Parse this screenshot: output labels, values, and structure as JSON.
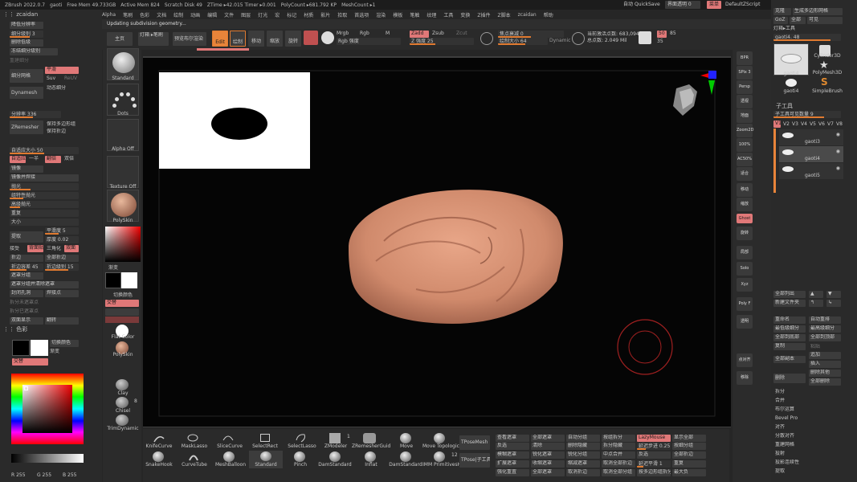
{
  "titlebar": {
    "app": "ZBrush 2022.0.7",
    "doc": "gaoti",
    "freemem": "Free Mem 49.733GB",
    "activemem": "Active Mem 824",
    "scratch": "Scratch Disk 49",
    "ztime": "ZTime ▸42.015 Timer ▸0.001",
    "polycount": "PolyCount ▸681.792 KP",
    "meshcount": "MeshCount ▸1",
    "auto": "自动",
    "quicksave": "QuickSave",
    "transparency": "界面透明 0",
    "menu": "菜单",
    "script": "DefaultZScript"
  },
  "menubar": [
    "Alpha",
    "笔刷",
    "色彩",
    "文档",
    "绘制",
    "动画",
    "编辑",
    "文件",
    "图层",
    "灯光",
    "宏",
    "标记",
    "材质",
    "影片",
    "拾取",
    "首选项",
    "渲染",
    "模板",
    "笔触",
    "纹理",
    "工具",
    "变换",
    "Z插件",
    "Z脚本",
    "zcaidan",
    "帮助"
  ],
  "status": "Updating subdivision geometry...",
  "toolbar": {
    "home": "主页",
    "lightbox": "灯箱 ▸笔刷",
    "preview": "预览布尔渲染",
    "edit": "Edit",
    "draw": "绘制",
    "move": "移动",
    "scale": "缩放",
    "rotate": "旋转",
    "mrgb": "Mrgb",
    "rgb": "Rgb",
    "m": "M",
    "zadd": "Zadd",
    "zsub": "Zsub",
    "zcut": "Zcut",
    "rgb_intensity": "Rgb 强度",
    "z_intensity": "Z 强度 25",
    "focal": "焦点衰减 0",
    "draw_size": "绘制大小 64",
    "dynamic": "Dynamic",
    "active_pts": "当前激活点数: 683,094",
    "total_pts": "总点数: 2.049 Mil",
    "num1": "50",
    "num2": "85",
    "num3": "35"
  },
  "left": {
    "title": "zcaidan",
    "items": [
      "降低分辨率",
      "细分级别 3",
      "删除低级",
      "冻结细分级别",
      "重建细分",
      "细分网格",
      "平滑",
      "Suv",
      "ReUV",
      "Dynamesh",
      "动态细分",
      "分辨率 336",
      "自适应大小 50",
      "ZRemesher",
      "保持多边形组",
      "保持折边",
      "自适应",
      "一半",
      "翻倍",
      "双倍",
      "镜像",
      "镜像并焊接",
      "抛光",
      "组特性抛光",
      "高级抛光",
      "重复",
      "大小",
      "平滑度 5",
      "厚度 0.02",
      "提取",
      "接受",
      "背面贴",
      "三角化",
      "双面",
      "折边",
      "全部折边",
      "折边容差 45",
      "折边级别 15",
      "遮罩分组",
      "遮罩分组并清除遮罩",
      "封闭孔洞",
      "焊接点",
      "拆分未遮罩点",
      "拆分已遮罩点",
      "双面显示",
      "翻转"
    ],
    "color_title": "色彩",
    "switch_color": "切换颜色",
    "gradient": "渐变",
    "alternate": "交替",
    "r": "R 255",
    "g": "G 255",
    "b": "B 255"
  },
  "tools_col": {
    "standard": "Standard",
    "dots": "Dots",
    "alphaoff": "Alpha Off",
    "textureoff": "Texture Off",
    "polyskin": "PolySkin",
    "gradient": "渐变",
    "switch_color": "切换颜色",
    "alternate": "交替",
    "flatcolor": "Flat Color",
    "polyskin2": "PolySkin",
    "clay": "Clay",
    "chisel": "Chisel",
    "trimdynamic": "TrimDynamic",
    "eight": "8"
  },
  "right_icons": [
    "BPR",
    "SPix 3",
    "Persp",
    "透视",
    "地面",
    "Zoom2D",
    "100%",
    "AC50%",
    "适合",
    "移动",
    "缩放",
    "旋转",
    "Poly F",
    "透明",
    "Ghost",
    "Solo",
    "Xyz",
    "点对齐",
    "移除",
    "局部"
  ],
  "right_panel": {
    "top_items": [
      "克隆",
      "生成多边形网格",
      "GoZ",
      "全部",
      "可见",
      "灯箱▸工具",
      "gaoti4. 48"
    ],
    "tools": [
      "gaoti4",
      "Cylinder3D",
      "PolyMesh3D",
      "gaoti4",
      "SimpleBrush"
    ],
    "subtool_title": "子工具",
    "visible_count": "子工具可见数量 9",
    "vtabs": [
      "V1",
      "V2",
      "V3",
      "V4",
      "V5",
      "V6",
      "V7",
      "V8"
    ],
    "subtools": [
      "gaoti3",
      "gaoti4",
      "gaoti5"
    ],
    "list_all": "全部列出",
    "new_folder": "新建文件夹",
    "actions": [
      "重命名",
      "自动重排",
      "最低级细分",
      "最高级细分",
      "全部到底部",
      "全部到顶部",
      "复制",
      "粘贴",
      "全部副本",
      "追加",
      "插入",
      "删除",
      "删除其他",
      "全部删除",
      "拆分",
      "合并",
      "布尔运算",
      "Bevel Pro",
      "对齐",
      "分散对齐",
      "重建网格",
      "投射",
      "投影连续性",
      "提取"
    ]
  },
  "bottom": {
    "brushes": [
      "KnifeCurve",
      "MaskLasso",
      "SliceCurve",
      "SelectRect",
      "SelectLasso",
      "ZModeler",
      "ZRemesherGuid",
      "Move",
      "Move Topologica",
      "SnakeHook",
      "CurveTube",
      "MeshBalloon",
      "Standard",
      "Pinch",
      "DamStandard",
      "Inflat",
      "DamStandard",
      "IMM PrimitivesH"
    ],
    "nums": [
      "1",
      "12"
    ],
    "tpose1": "TPoseMesh",
    "tpose2": "TPose|子工具",
    "cols": [
      "查看遮罩",
      "反选",
      "全部遮罩",
      "清除",
      "自动分组",
      "删除隐藏",
      "按组拆分",
      "拆分隐藏",
      "模糊遮罩",
      "锐化遮罩",
      "锐化分组",
      "中点合并",
      "LazyMouse",
      "延迟步进 0.25",
      "扩展遮罩",
      "收缩遮罩",
      "缩减遮罩",
      "取消全部折边",
      "反选",
      "延迟平滑 1",
      "强化重置",
      "全部遮罩",
      "取消折边",
      "取消全部分组",
      "按多边形组拆分",
      "显示全部",
      "按细分组",
      "全部折边",
      "重复",
      "最大负"
    ]
  }
}
